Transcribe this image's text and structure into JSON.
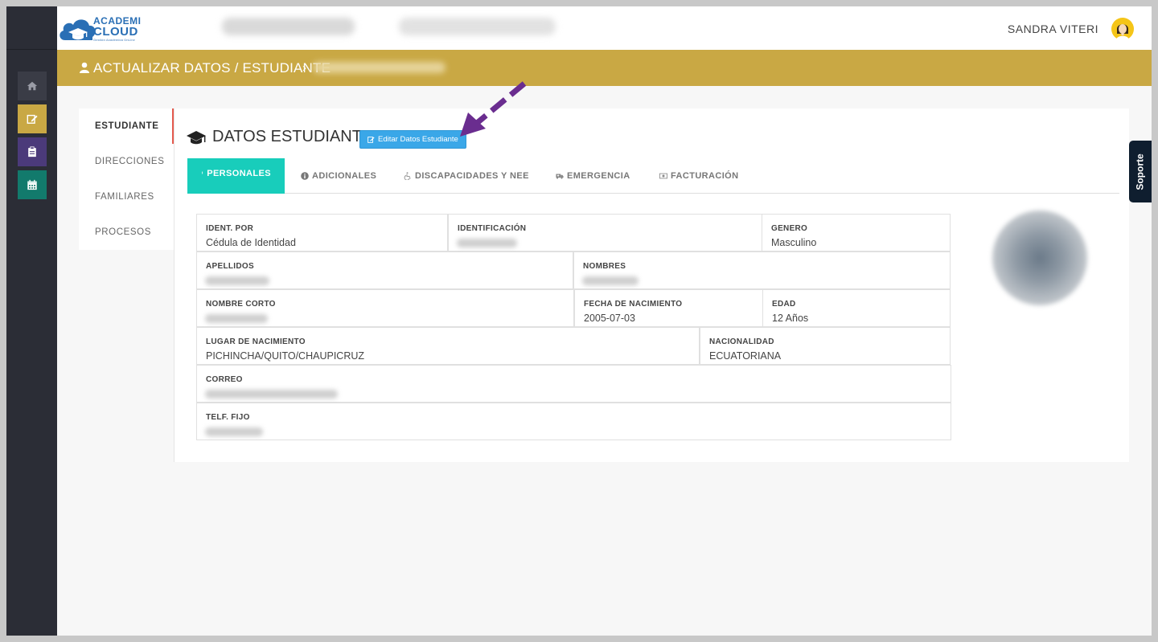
{
  "header": {
    "logo_line1": "ACADEMI",
    "logo_line2": "CLOUD",
    "logo_tagline": "Gestión Académica OnLine",
    "user_name": "SANDRA VITERI"
  },
  "sidebar": {
    "buttons": [
      {
        "icon": "home-icon",
        "color": "#3a3c46"
      },
      {
        "icon": "edit-icon",
        "color": "#c9a844"
      },
      {
        "icon": "clipboard-icon",
        "color": "#4b3a7a"
      },
      {
        "icon": "calendar-icon",
        "color": "#127a6c"
      }
    ]
  },
  "breadcrumb": {
    "title": "ACTUALIZAR DATOS / ESTUDIANTE",
    "separator": "›"
  },
  "side_menu": {
    "items": [
      {
        "label": "ESTUDIANTE",
        "active": true
      },
      {
        "label": "DIRECCIONES",
        "active": false
      },
      {
        "label": "FAMILIARES",
        "active": false
      },
      {
        "label": "PROCESOS",
        "active": false
      }
    ]
  },
  "panel": {
    "title": "DATOS ESTUDIANTE",
    "edit_button": "Editar Datos Estudiante"
  },
  "tabs": [
    {
      "label": "PERSONALES",
      "icon": "person-icon",
      "active": true
    },
    {
      "label": "ADICIONALES",
      "icon": "info-icon",
      "active": false
    },
    {
      "label": "DISCAPACIDADES Y NEE",
      "icon": "wheelchair-icon",
      "active": false
    },
    {
      "label": "EMERGENCIA",
      "icon": "ambulance-icon",
      "active": false
    },
    {
      "label": "FACTURACIÓN",
      "icon": "money-icon",
      "active": false
    }
  ],
  "fields": {
    "ident_por": {
      "label": "IDENT. POR",
      "value": "Cédula de Identidad"
    },
    "identificacion": {
      "label": "IDENTIFICACIÓN",
      "value": ""
    },
    "genero": {
      "label": "GENERO",
      "value": "Masculino"
    },
    "apellidos": {
      "label": "APELLIDOS",
      "value": ""
    },
    "nombres": {
      "label": "NOMBRES",
      "value": ""
    },
    "nombre_corto": {
      "label": "NOMBRE CORTO",
      "value": ""
    },
    "fecha_nacimiento": {
      "label": "FECHA DE NACIMIENTO",
      "value": "2005-07-03"
    },
    "edad": {
      "label": "EDAD",
      "value": "12 Años"
    },
    "lugar_nacimiento": {
      "label": "LUGAR DE NACIMIENTO",
      "value": "PICHINCHA/QUITO/CHAUPICRUZ"
    },
    "nacionalidad": {
      "label": "NACIONALIDAD",
      "value": "ECUATORIANA"
    },
    "correo": {
      "label": "CORREO",
      "value": ""
    },
    "telf_fijo": {
      "label": "TELF. FIJO",
      "value": ""
    }
  },
  "support_tab": "Soporte",
  "colors": {
    "gold": "#c9a844",
    "teal": "#18cdbb",
    "button_blue": "#3aa7e8",
    "rail": "#2b2d36",
    "arrow": "#6a2d8f"
  }
}
